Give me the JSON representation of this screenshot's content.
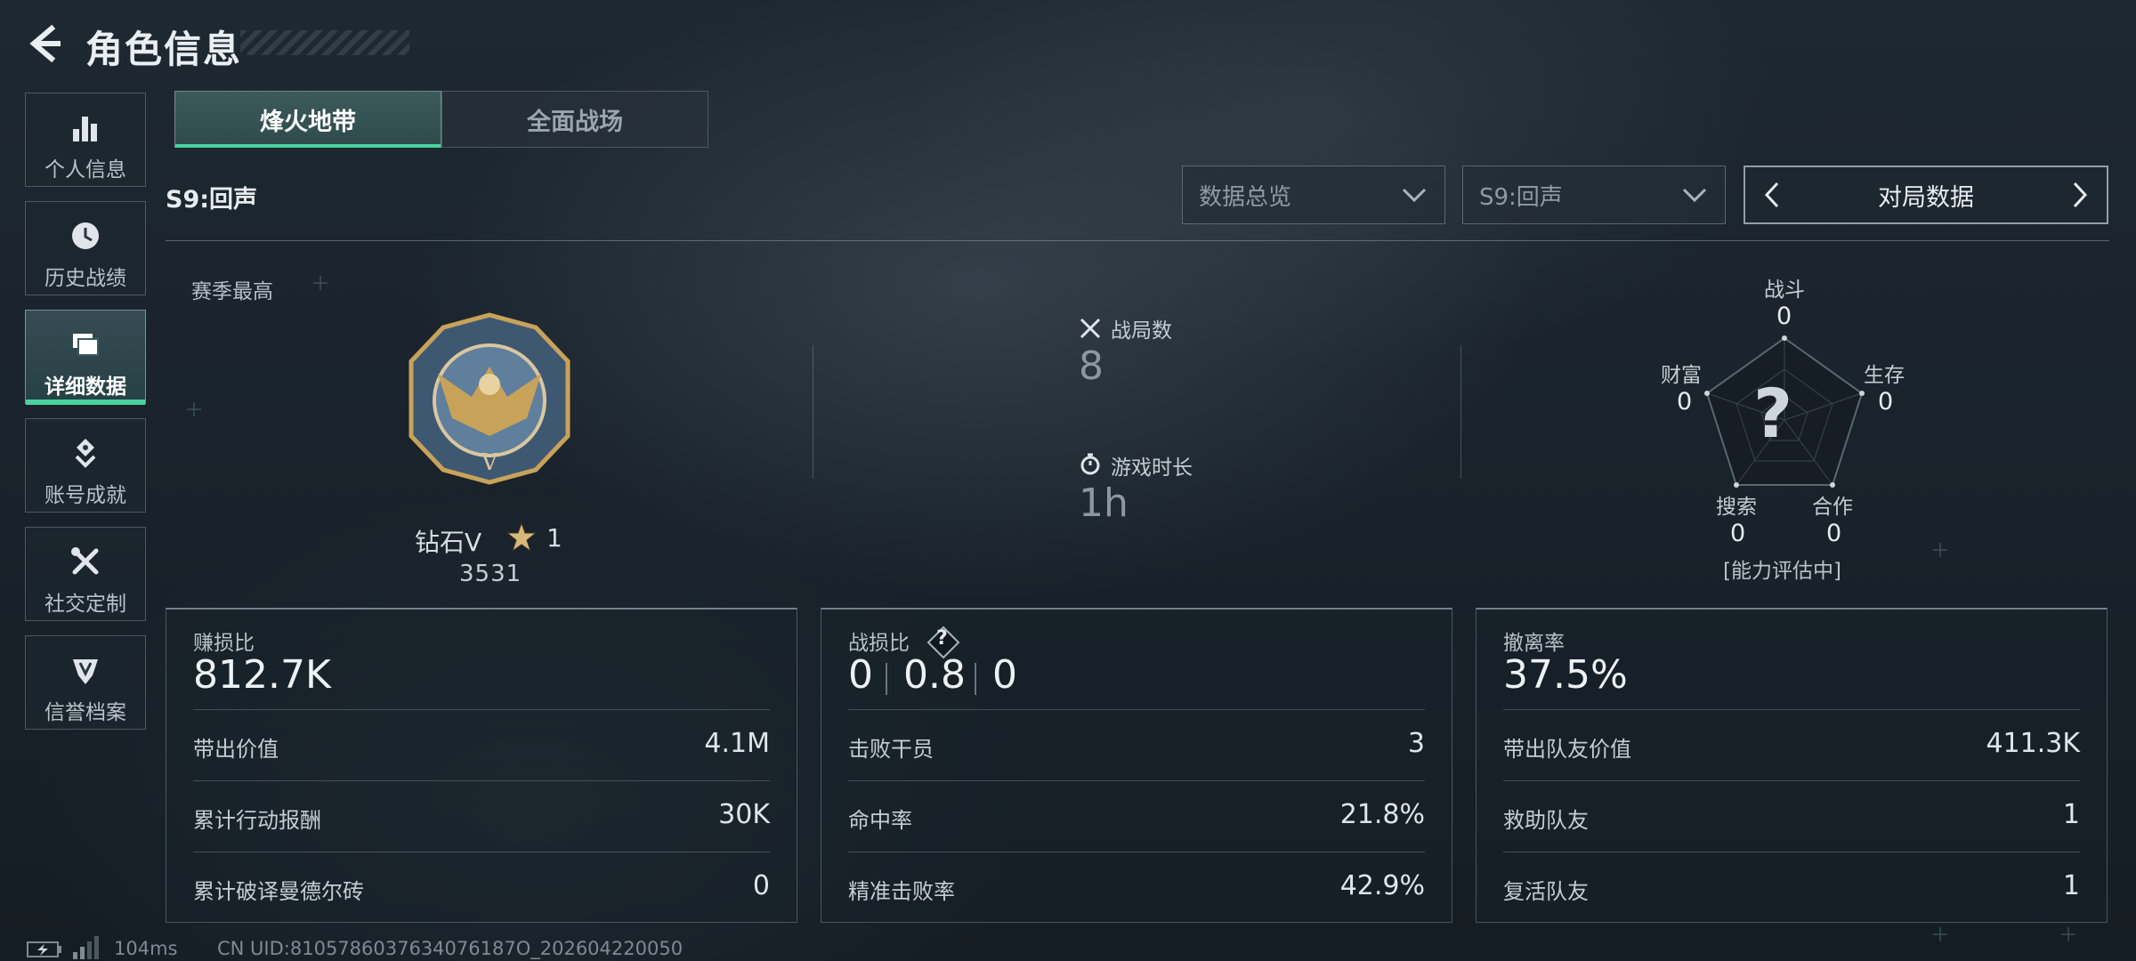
{
  "header": {
    "title": "角色信息"
  },
  "sidebar": {
    "items": [
      {
        "label": "个人信息",
        "icon": "bar-chart-icon"
      },
      {
        "label": "历史战绩",
        "icon": "history-clock-icon"
      },
      {
        "label": "详细数据",
        "icon": "folder-stack-icon",
        "active": true
      },
      {
        "label": "账号成就",
        "icon": "achievement-badge-icon"
      },
      {
        "label": "社交定制",
        "icon": "crossed-tools-icon"
      },
      {
        "label": "信誉档案",
        "icon": "shield-emblem-icon"
      }
    ]
  },
  "mode_tabs": [
    {
      "label": "烽火地带",
      "active": true
    },
    {
      "label": "全面战场",
      "active": false
    }
  ],
  "season_label": "S9:回声",
  "filters": {
    "view": "数据总览",
    "season": "S9:回声",
    "pager_label": "对局数据"
  },
  "rank": {
    "section_label": "赛季最高",
    "name": "钻石V",
    "stars": "1",
    "score": "3531"
  },
  "matches": {
    "label": "战局数",
    "value": "8"
  },
  "playtime": {
    "label": "游戏时长",
    "value": "1h"
  },
  "radar": {
    "labels": {
      "combat": "战斗",
      "survival": "生存",
      "cooperation": "合作",
      "search": "搜索",
      "wealth": "财富"
    },
    "values": {
      "combat": "0",
      "survival": "0",
      "cooperation": "0",
      "search": "0",
      "wealth": "0"
    },
    "center_mark": "?",
    "status": "[能力评估中]"
  },
  "panels": {
    "profit": {
      "title": "赚损比",
      "value": "812.7K",
      "rows": [
        {
          "label": "带出价值",
          "value": "4.1M"
        },
        {
          "label": "累计行动报酬",
          "value": "30K"
        },
        {
          "label": "累计破译曼德尔砖",
          "value": "0"
        }
      ]
    },
    "combat": {
      "title": "战损比",
      "help": "?",
      "kda": [
        "0",
        "0.8",
        "0"
      ],
      "rows": [
        {
          "label": "击败干员",
          "value": "3"
        },
        {
          "label": "命中率",
          "value": "21.8%"
        },
        {
          "label": "精准击败率",
          "value": "42.9%"
        }
      ]
    },
    "extract": {
      "title": "撤离率",
      "value": "37.5%",
      "rows": [
        {
          "label": "带出队友价值",
          "value": "411.3K"
        },
        {
          "label": "救助队友",
          "value": "1"
        },
        {
          "label": "复活队友",
          "value": "1"
        }
      ]
    }
  },
  "footer": {
    "ping": "104ms",
    "uid": "CN UID:8105786037634076187O_202604220050"
  },
  "colors": {
    "accent": "#49d39f",
    "background": "#1a232b"
  }
}
